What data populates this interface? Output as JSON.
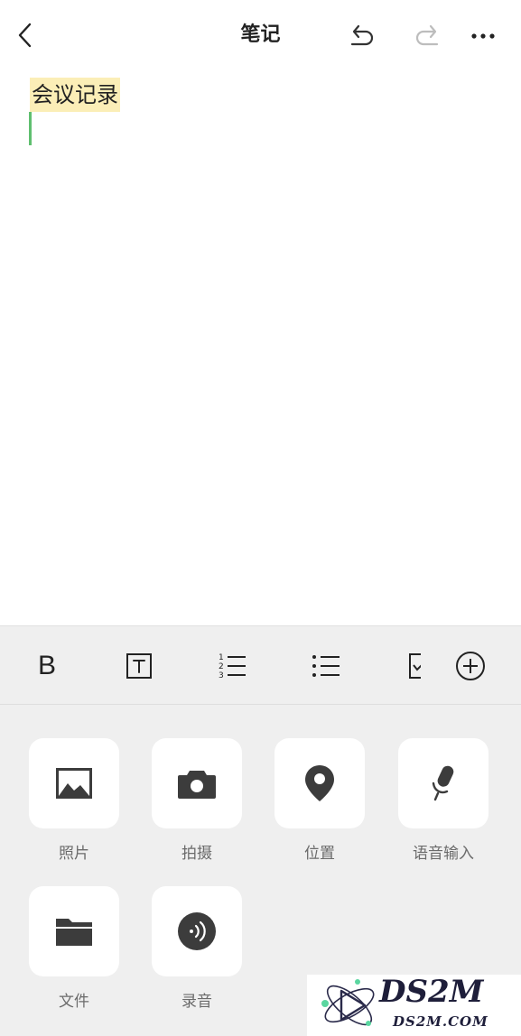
{
  "header": {
    "title": "笔记",
    "back_icon": "chevron-left-icon",
    "undo_icon": "undo-icon",
    "redo_icon": "redo-icon",
    "more_icon": "more-horizontal-icon"
  },
  "editor": {
    "title_text": "会议记录",
    "highlight_color": "#fbeeb7",
    "caret_color": "#5fbf6f"
  },
  "toolbar": {
    "bold_label": "B",
    "items": [
      "bold-icon",
      "text-format-icon",
      "numbered-list-icon",
      "bullet-list-icon",
      "checkbox-list-icon",
      "add-circle-icon"
    ]
  },
  "attachments": {
    "items": [
      {
        "label": "照片",
        "icon": "photo-icon"
      },
      {
        "label": "拍摄",
        "icon": "camera-icon"
      },
      {
        "label": "位置",
        "icon": "location-pin-icon"
      },
      {
        "label": "语音输入",
        "icon": "microphone-icon"
      },
      {
        "label": "文件",
        "icon": "folder-icon"
      },
      {
        "label": "录音",
        "icon": "audio-record-icon"
      }
    ]
  },
  "watermark": {
    "brand": "DS2M",
    "domain": "DS2M.COM"
  },
  "colors": {
    "panel_bg": "#efefef",
    "icon_dark": "#3c3c3c",
    "label_gray": "#6b6b6b"
  }
}
